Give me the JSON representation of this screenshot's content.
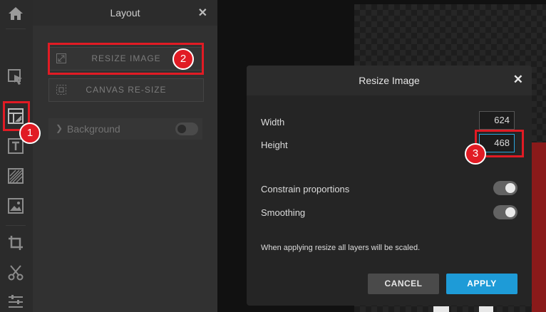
{
  "panel": {
    "title": "Layout",
    "close": "✕",
    "resize_image_label": "RESIZE IMAGE",
    "canvas_resize_label": "CANVAS RE-SIZE",
    "background_label": "Background",
    "background_toggle_on": false
  },
  "dialog": {
    "title": "Resize Image",
    "close": "✕",
    "width_label": "Width",
    "width_value": "624",
    "height_label": "Height",
    "height_value": "468",
    "constrain_label": "Constrain proportions",
    "constrain_on": true,
    "smoothing_label": "Smoothing",
    "smoothing_on": true,
    "note": "When applying resize all layers will be scaled.",
    "cancel_label": "CANCEL",
    "apply_label": "APPLY"
  },
  "annotations": {
    "badge1": "1",
    "badge2": "2",
    "badge3": "3",
    "color": "#e11b24"
  },
  "toolbar": {
    "icons": [
      "home-icon",
      "select-icon",
      "layout-icon",
      "text-icon",
      "fill-icon",
      "image-icon",
      "crop-icon",
      "cut-icon",
      "adjust-icon"
    ]
  }
}
